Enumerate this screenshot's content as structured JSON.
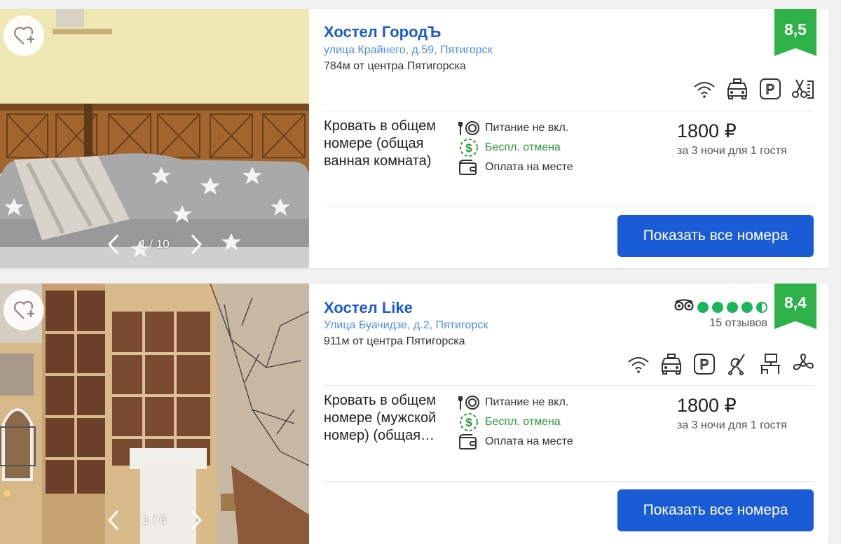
{
  "hotels": [
    {
      "name": "Хостел ГородЪ",
      "address": "улица Крайнего, д.59, Пятигорск",
      "distance": "784м от центра Пятигорска",
      "rating": "8,5",
      "photo_counter": "1 / 10",
      "amenities": [
        "wifi-icon",
        "taxi-icon",
        "parking-icon",
        "hairdresser-icon"
      ],
      "room": "Кровать в общем номере (общая ванная комната)",
      "features": {
        "meal": "Питание не вкл.",
        "cancel": "Беспл. отмена",
        "payment": "Оплата на месте"
      },
      "price": "1800 ₽",
      "price_note": "за 3 ночи для 1 гостя",
      "button": "Показать все номера"
    },
    {
      "name": "Хостел Like",
      "address": "Улица Буачидзе, д.2, Пятигорск",
      "distance": "911м от центра Пятигорска",
      "rating": "8,4",
      "reviews": "15 отзывов",
      "tripadvisor_score": 4.5,
      "photo_counter": "1 / 6",
      "amenities": [
        "wifi-icon",
        "taxi-icon",
        "parking-icon",
        "stroller-icon",
        "desk-icon",
        "fan-icon"
      ],
      "room": "Кровать в общем номере (мужской номер) (общая…",
      "features": {
        "meal": "Питание не вкл.",
        "cancel": "Беспл. отмена",
        "payment": "Оплата на месте"
      },
      "price": "1800 ₽",
      "price_note": "за 3 ночи для 1 гостя",
      "button": "Показать все номера"
    }
  ],
  "colors": {
    "brand": "#1a5bd6",
    "rating": "#2fb14a",
    "green": "#2a9a33",
    "tripadvisor": "#1bb55c"
  }
}
